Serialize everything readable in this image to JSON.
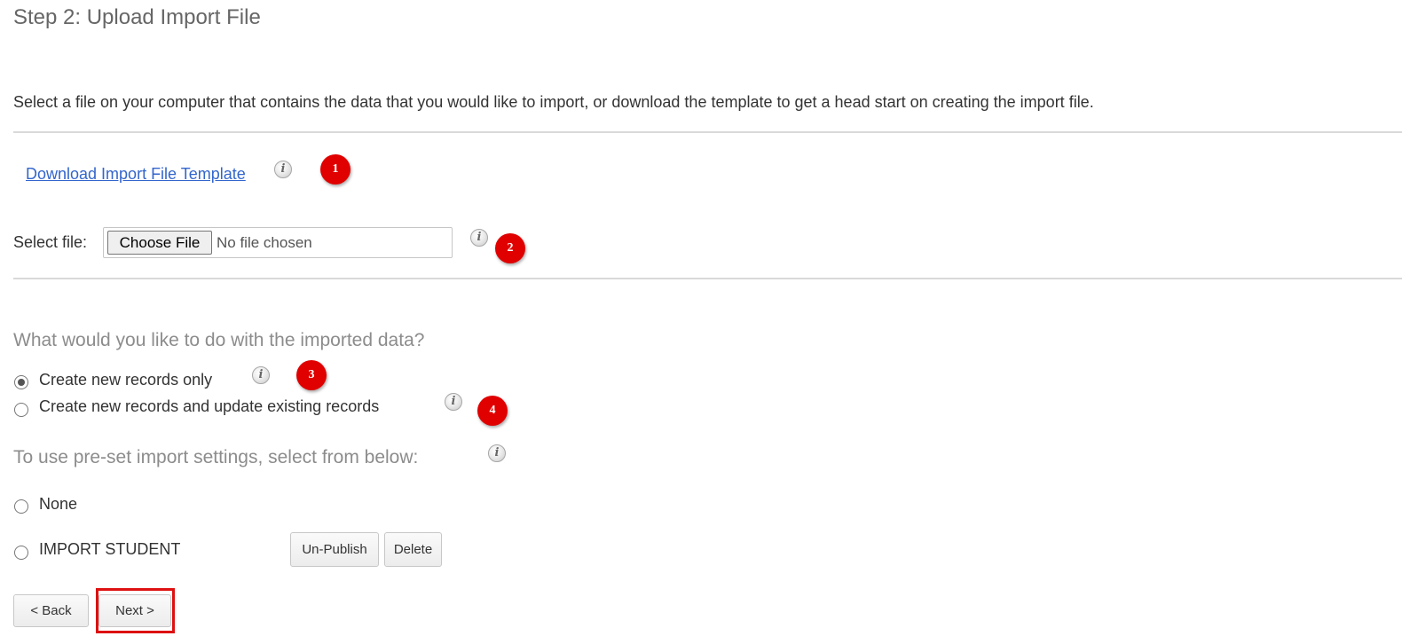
{
  "page": {
    "title": "Step 2: Upload Import File",
    "description": "Select a file on your computer that contains the data that you would like to import, or download the template to get a head start on creating the import file."
  },
  "template": {
    "link_label": "Download Import File Template",
    "badge": "1"
  },
  "file_select": {
    "label": "Select file:",
    "button_label": "Choose File",
    "status": "No file chosen",
    "badge": "2"
  },
  "import_mode": {
    "question": "What would you like to do with the imported data?",
    "options": [
      {
        "label": "Create new records only",
        "selected": true,
        "badge": "3"
      },
      {
        "label": "Create new records and update existing records",
        "selected": false,
        "badge": "4"
      }
    ]
  },
  "preset": {
    "question": "To use pre-set import settings, select from below:",
    "options": [
      {
        "label": "None",
        "selected": false
      },
      {
        "label": "IMPORT STUDENT",
        "selected": false,
        "unpublish_label": "Un-Publish",
        "delete_label": "Delete"
      }
    ]
  },
  "nav": {
    "back_label": "< Back",
    "next_label": "Next >"
  },
  "colors": {
    "link": "#3366cc",
    "badge": "#e00000",
    "highlight": "#dd1111"
  },
  "icons": {
    "info": "i"
  }
}
